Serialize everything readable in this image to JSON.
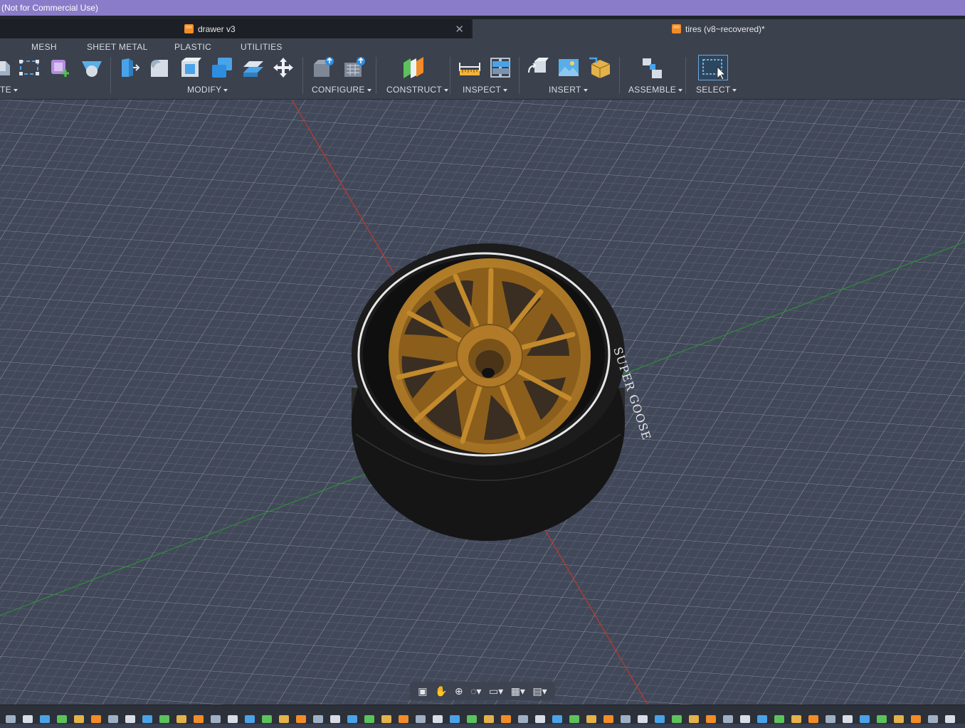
{
  "window": {
    "title": "(Not for Commercial Use)"
  },
  "tabs": [
    {
      "label": "drawer v3",
      "active": false
    },
    {
      "label": "tires (v8~recovered)*",
      "active": true
    }
  ],
  "ribbon_tabs": [
    "MESH",
    "SHEET METAL",
    "PLASTIC",
    "UTILITIES"
  ],
  "groups": {
    "create": "TE",
    "modify": "MODIFY",
    "configure": "CONFIGURE",
    "construct": "CONSTRUCT",
    "inspect": "INSPECT",
    "insert": "INSERT",
    "assemble": "ASSEMBLE",
    "select": "SELECT"
  },
  "model": {
    "sidewall_text": "SUPER GOOSE",
    "rim_color": "#b07a28",
    "tire_color": "#1b1b1b"
  },
  "colors": {
    "title_bar": "#8a7cc8",
    "toolbar": "#3b414d",
    "viewport": "#3f4556",
    "grid": "#c8cdd6",
    "x_axis": "#c0392b",
    "y_axis": "#2e8b3a"
  },
  "nav_icons": [
    "orbit-lock-icon",
    "pan-icon",
    "zoom-icon",
    "fit-icon",
    "display-settings-icon",
    "grid-icon",
    "viewports-icon"
  ]
}
